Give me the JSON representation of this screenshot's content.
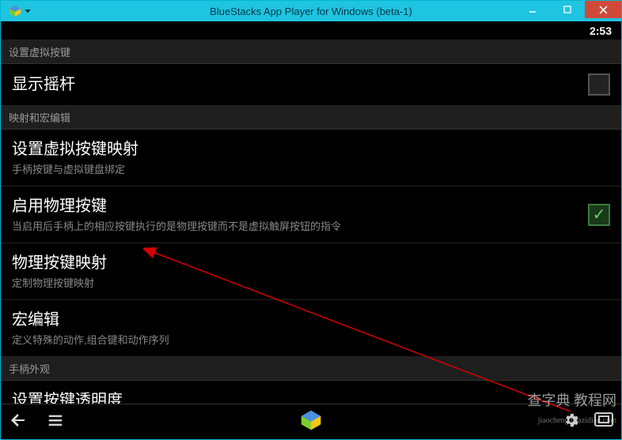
{
  "window": {
    "title": "BlueStacks App Player for Windows (beta-1)"
  },
  "status": {
    "time": "2:53"
  },
  "screen": {
    "header": "设置虚拟按键",
    "show_joystick": {
      "title": "显示摇杆",
      "checked": false
    },
    "section_mapping": "映射和宏编辑",
    "virtual_mapping": {
      "title": "设置虚拟按键映射",
      "sub": "手柄按键与虚拟键盘绑定"
    },
    "enable_physical": {
      "title": "启用物理按键",
      "sub": "当启用后手柄上的相应按键执行的是物理按键而不是虚拟触屏按钮的指令",
      "checked": true
    },
    "physical_mapping": {
      "title": "物理按键映射",
      "sub": "定制物理按键映射"
    },
    "macro_edit": {
      "title": "宏编辑",
      "sub": "定义特殊的动作,组合键和动作序列"
    },
    "section_appearance": "手柄外观",
    "opacity": {
      "title": "设置按键透明度"
    }
  },
  "watermark": {
    "main": "查字典 教程网",
    "sub": "jiaocheng.chazidian.com"
  }
}
